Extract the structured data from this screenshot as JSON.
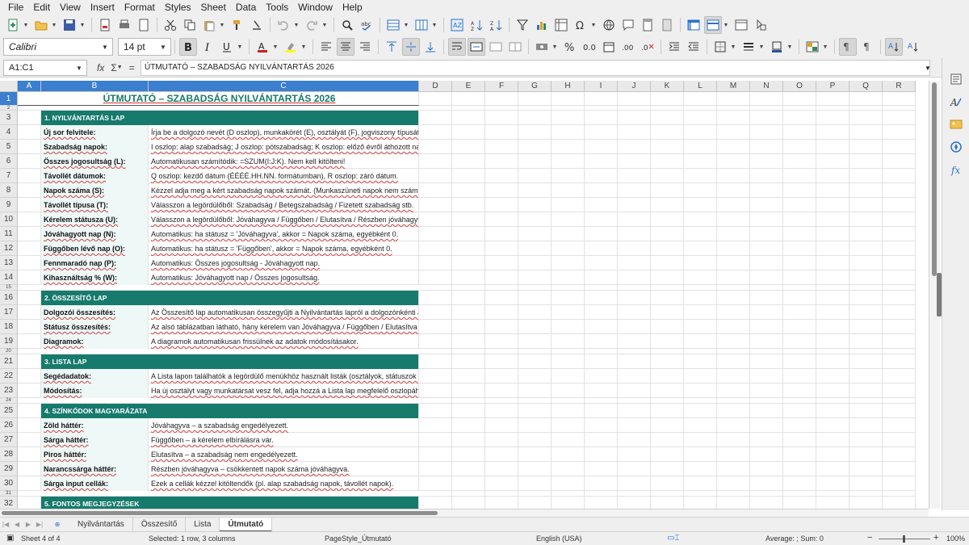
{
  "menubar": [
    "File",
    "Edit",
    "View",
    "Insert",
    "Format",
    "Styles",
    "Sheet",
    "Data",
    "Tools",
    "Window",
    "Help"
  ],
  "toolbar2": {
    "font_name": "Calibri",
    "font_size": "14 pt"
  },
  "formulabar": {
    "cell_ref": "A1:C1",
    "fx": "fx",
    "sigma": "Σ",
    "equals": "=",
    "content": "ÚTMUTATÓ – SZABADSÁG NYILVÁNTARTÁS 2026"
  },
  "columns": [
    "A",
    "B",
    "C",
    "D",
    "E",
    "F",
    "G",
    "H",
    "I",
    "J",
    "K",
    "L",
    "M",
    "N",
    "O",
    "P",
    "Q",
    "R"
  ],
  "sheet": {
    "title": "ÚTMUTATÓ – SZABADSÁG NYILVÁNTARTÁS 2026",
    "rows": [
      {
        "n": "1",
        "type": "title"
      },
      {
        "n": "2",
        "type": "blank"
      },
      {
        "n": "3",
        "type": "section",
        "text": "1. NYILVÁNTARTÁS LAP"
      },
      {
        "n": "4",
        "type": "item",
        "label": "Új sor felvitele:",
        "desc": "Írja be a dolgozó nevét (D oszlop), munkakörét (E), osztályát (F), jogviszony típusát (G)."
      },
      {
        "n": "5",
        "type": "item",
        "label": "Szabadság napok:",
        "desc": "I oszlop: alap szabadság; J oszlop: pótszabadság; K oszlop: előző évről áthozott napok."
      },
      {
        "n": "6",
        "type": "item",
        "label": "Összes jogosultság (L):",
        "desc": "Automatikusan számítódik: =SZUM(I:J:K). Nem kell kitölteni!"
      },
      {
        "n": "7",
        "type": "item",
        "label": "Távollét dátumok:",
        "desc": "Q oszlop: kezdő dátum (ÉÉÉÉ.HH.NN. formátumban), R oszlop: záró dátum."
      },
      {
        "n": "8",
        "type": "item",
        "label": "Napok száma (S):",
        "desc": "Kézzel adja meg a kért szabadság napok számát. (Munkaszüneti napok nem számítanak.)"
      },
      {
        "n": "9",
        "type": "item",
        "label": "Távollét típusa (T):",
        "desc": "Válasszon a legördülőből: Szabadság / Betegszabadság / Fizetett szabadság stb."
      },
      {
        "n": "10",
        "type": "item",
        "label": "Kérelem státusza (U):",
        "desc": "Válasszon a legördülőből: Jóváhagyva / Függőben / Elutasítva / Részben jóváhagyva."
      },
      {
        "n": "11",
        "type": "item",
        "label": "Jóváhagyott nap (N):",
        "desc": "Automatikus: ha státusz = 'Jóváhagyva', akkor = Napok száma, egyébként 0."
      },
      {
        "n": "12",
        "type": "item",
        "label": "Függőben lévő nap (O):",
        "desc": "Automatikus: ha státusz = 'Függőben', akkor = Napok száma, egyébként 0."
      },
      {
        "n": "13",
        "type": "item",
        "label": "Fennmaradó nap (P):",
        "desc": "Automatikus: Összes jogosultság - Jóváhagyott nap."
      },
      {
        "n": "14",
        "type": "item",
        "label": "Kihasználtság % (W):",
        "desc": "Automatikus: Jóváhagyott nap / Összes jogosultság."
      },
      {
        "n": "15",
        "type": "blank"
      },
      {
        "n": "16",
        "type": "section",
        "text": "2. ÖSSZESÍTŐ LAP"
      },
      {
        "n": "17",
        "type": "item",
        "label": "Dolgozói összesítés:",
        "desc": "Az Összesítő lap automatikusan összegyűjti a Nyilvántartás lapról a dolgozónkénti adatokat."
      },
      {
        "n": "18",
        "type": "item",
        "label": "Státusz összesítés:",
        "desc": "Az alsó táblázatban látható, hány kérelem van Jóváhagyva / Függőben / Elutasítva állapotban."
      },
      {
        "n": "19",
        "type": "item",
        "label": "Diagramok:",
        "desc": "A diagramok automatikusan frissülnek az adatok módosításakor."
      },
      {
        "n": "20",
        "type": "blank"
      },
      {
        "n": "21",
        "type": "section",
        "text": "3. LISTA LAP"
      },
      {
        "n": "22",
        "type": "item",
        "label": "Segédadatok:",
        "desc": "A Lista lapon találhatók a legördülő menükhöz használt listák (osztályok, státuszok stb.)."
      },
      {
        "n": "23",
        "type": "item",
        "label": "Módosítás:",
        "desc": "Ha új osztályt vagy munkatársat vesz fel, adja hozzá a Lista lap megfelelő oszlopához."
      },
      {
        "n": "24",
        "type": "blank"
      },
      {
        "n": "25",
        "type": "section",
        "text": "4. SZÍNKÓDOK MAGYARÁZATA"
      },
      {
        "n": "26",
        "type": "item",
        "label": "Zöld háttér:",
        "desc": "Jóváhagyva – a szabadság engedélyezett."
      },
      {
        "n": "27",
        "type": "item",
        "label": "Sárga háttér:",
        "desc": "Függőben – a kérelem elbírálásra vár."
      },
      {
        "n": "28",
        "type": "item",
        "label": "Piros háttér:",
        "desc": "Elutasítva – a szabadság nem engedélyezett."
      },
      {
        "n": "29",
        "type": "item",
        "label": "Narancssárga háttér:",
        "desc": "Részben jóváhagyva – csökkentett napok száma jóváhagyva."
      },
      {
        "n": "30",
        "type": "item",
        "label": "Sárga input cellák:",
        "desc": "Ezek a cellák kézzel kitöltendők (pl. alap szabadság napok, távollét napok)."
      },
      {
        "n": "31",
        "type": "blank"
      },
      {
        "n": "32",
        "type": "section",
        "text": "5. FONTOS MEGJEGYZÉSEK"
      }
    ]
  },
  "tabs": [
    "Nyilvántartás",
    "Összesítő",
    "Lista",
    "Útmutató"
  ],
  "active_tab": "Útmutató",
  "status": {
    "sheet": "Sheet 4 of 4",
    "selection": "Selected: 1 row, 3 columns",
    "pagestyle": "PageStyle_Útmutató",
    "language": "English (USA)",
    "sum": "Average: ; Sum: 0",
    "zoom": "100%"
  },
  "colors": {
    "section": "#167a6d",
    "selection": "#3a7fd0",
    "label_bg": "#eef8f6"
  }
}
